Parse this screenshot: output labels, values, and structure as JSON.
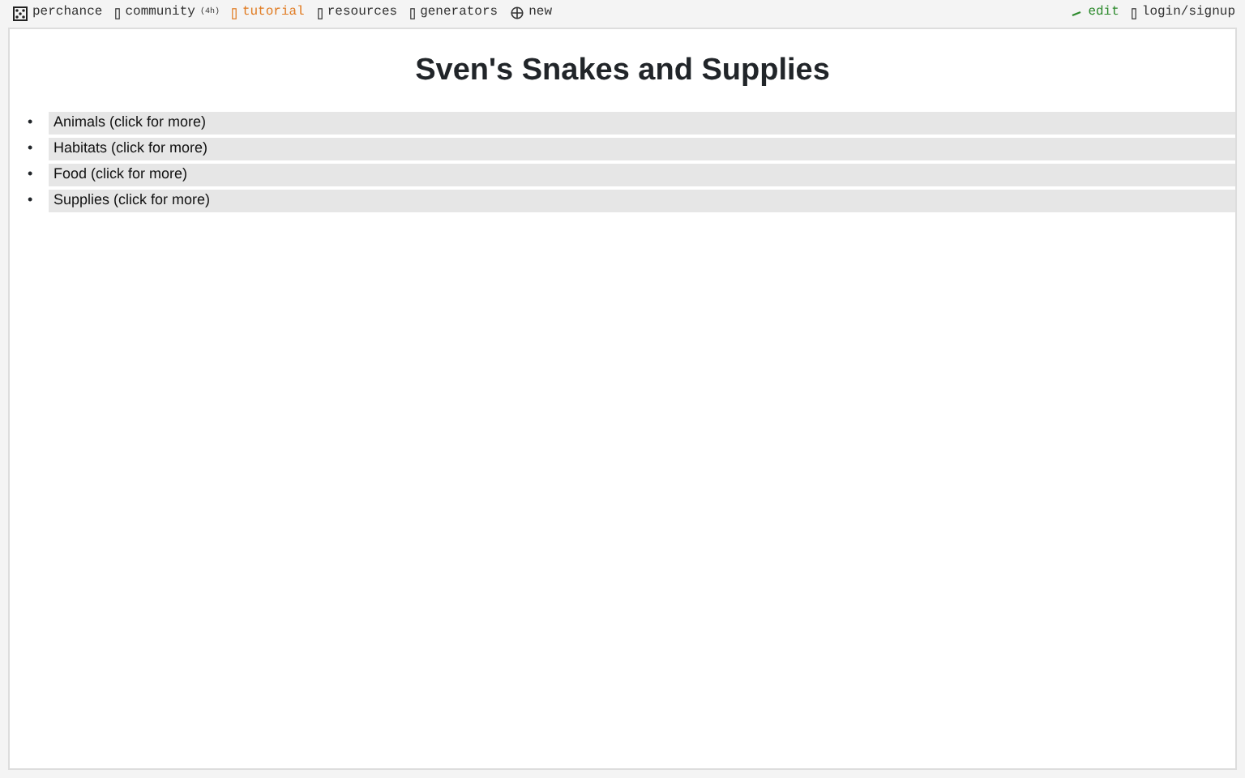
{
  "topbar": {
    "left": [
      {
        "kind": "dice",
        "label": "perchance"
      },
      {
        "kind": "box",
        "label": "community",
        "note": "(4h)"
      },
      {
        "kind": "box",
        "label": "tutorial",
        "highlight": true
      },
      {
        "kind": "box",
        "label": "resources"
      },
      {
        "kind": "box",
        "label": "generators"
      },
      {
        "kind": "plus",
        "label": "new"
      }
    ],
    "right": [
      {
        "kind": "pencil",
        "label": "edit",
        "highlight": true
      },
      {
        "kind": "box",
        "label": "login/signup"
      }
    ]
  },
  "page": {
    "title": "Sven's Snakes and Supplies",
    "items": [
      {
        "marker": "•",
        "label": "Animals (click for more)"
      },
      {
        "marker": "•",
        "label": "Habitats (click for more)"
      },
      {
        "marker": "•",
        "label": "Food (click for more)"
      },
      {
        "marker": "•",
        "label": "Supplies (click for more)"
      }
    ]
  }
}
